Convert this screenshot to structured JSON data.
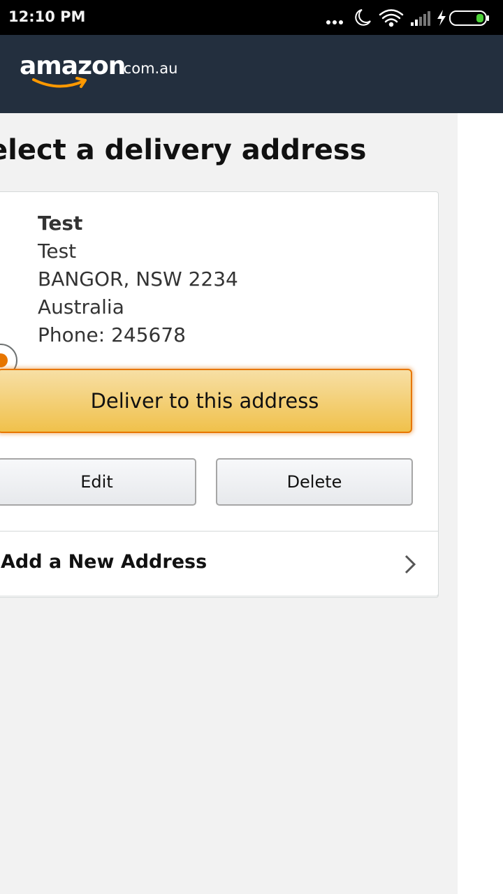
{
  "status_bar": {
    "time": "12:10 PM",
    "icons": [
      "more-dots-icon",
      "moon-icon",
      "wifi-icon",
      "signal-icon",
      "charging-bolt-icon",
      "battery-icon"
    ]
  },
  "header": {
    "logo_word": "amazon",
    "logo_domain": ".com.au"
  },
  "page": {
    "title": "elect a delivery address"
  },
  "address": {
    "name": "Test",
    "line1": "Test",
    "city_line": "BANGOR, NSW 2234",
    "country": "Australia",
    "phone": "Phone: 245678",
    "selected": true
  },
  "actions": {
    "deliver_label": "Deliver to this address",
    "edit_label": "Edit",
    "delete_label": "Delete"
  },
  "add_new": {
    "label": "Add a New Address"
  },
  "colors": {
    "header_bg": "#232f3e",
    "accent_orange": "#e77600",
    "button_yellow": "#f0c14b",
    "page_bg": "#f2f2f2"
  }
}
